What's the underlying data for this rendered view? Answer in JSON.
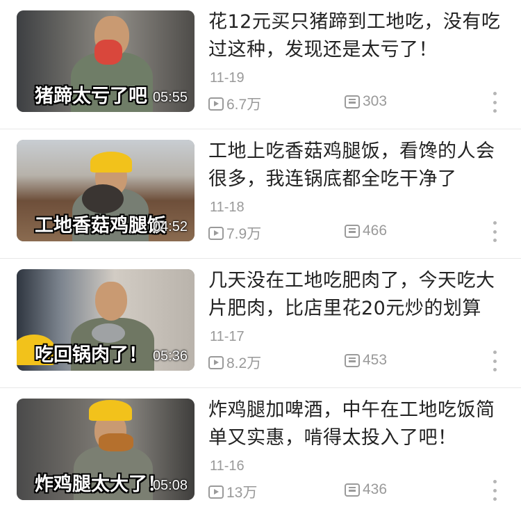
{
  "videos": [
    {
      "title": "花12元买只猪蹄到工地吃，没有吃过这种，发现还是太亏了！",
      "thumb_caption": "猪蹄太亏了吧",
      "duration": "05:55",
      "date": "11-19",
      "views": "6.7万",
      "danmaku": "303",
      "more_icon": "more-vertical-icon"
    },
    {
      "title": "工地上吃香菇鸡腿饭，看馋的人会很多，我连锅底都全吃干净了",
      "thumb_caption": "工地香菇鸡腿饭",
      "duration": "04:52",
      "date": "11-18",
      "views": "7.9万",
      "danmaku": "466",
      "more_icon": "more-vertical-icon"
    },
    {
      "title": "几天没在工地吃肥肉了，今天吃大片肥肉，比店里花20元炒的划算",
      "thumb_caption": "吃回锅肉了！",
      "duration": "05:36",
      "date": "11-17",
      "views": "8.2万",
      "danmaku": "453",
      "more_icon": "more-vertical-icon"
    },
    {
      "title": "炸鸡腿加啤酒，中午在工地吃饭简单又实惠，啃得太投入了吧！",
      "thumb_caption": "炸鸡腿太大了！",
      "duration": "05:08",
      "date": "11-16",
      "views": "13万",
      "danmaku": "436",
      "more_icon": "more-vertical-icon"
    }
  ],
  "icons": {
    "views": "play-count-icon",
    "danmaku": "danmaku-count-icon"
  },
  "colors": {
    "title": "#222222",
    "meta": "#999999",
    "helmet": "#f2c21b"
  }
}
